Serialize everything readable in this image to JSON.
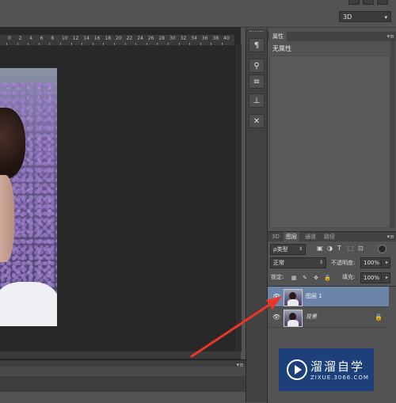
{
  "workspace": {
    "selected": "3D"
  },
  "ruler": {
    "labels": [
      "0",
      "2",
      "4",
      "6",
      "8",
      "10",
      "12",
      "14",
      "16",
      "18",
      "20",
      "22",
      "24",
      "26",
      "28",
      "30",
      "32",
      "34",
      "36",
      "38",
      "40"
    ]
  },
  "tools": [
    "paragraph-icon",
    "brush-preset-icon",
    "brush-settings-icon",
    "clone-source-icon",
    "tool-presets-icon"
  ],
  "properties": {
    "tab": "属性",
    "status": "无属性"
  },
  "layers": {
    "tabs": [
      "3D",
      "图层",
      "通道",
      "路径"
    ],
    "active_tab": "图层",
    "filter_kind": "ρ类型",
    "blend_mode": "正常",
    "opacity_label": "不透明度:",
    "opacity_value": "100%",
    "lock_label": "锁定:",
    "fill_label": "填充:",
    "fill_value": "100%",
    "items": [
      {
        "name": "图层 1",
        "selected": true,
        "locked": false
      },
      {
        "name": "背景",
        "selected": false,
        "locked": true
      }
    ]
  },
  "watermark": {
    "title": "溜溜自学",
    "url": "ZIXUE.3066.COM"
  },
  "colors": {
    "selected_layer": "#6c84a8",
    "arrow": "#e8372b",
    "watermark_bg": "#1d3f7a"
  }
}
